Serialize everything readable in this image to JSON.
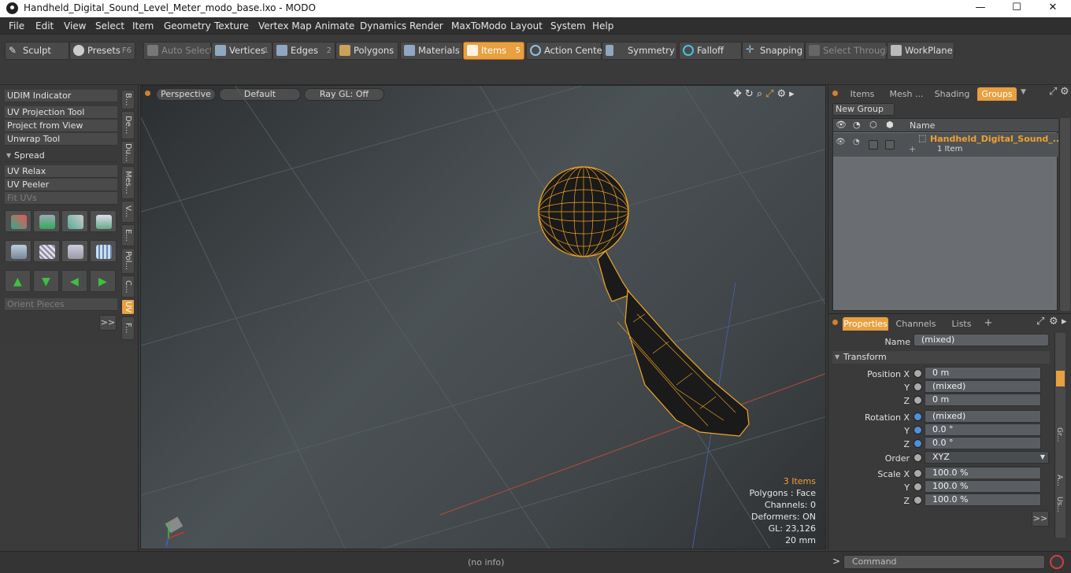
{
  "window": {
    "title": "Handheld_Digital_Sound_Level_Meter_modo_base.lxo - MODO",
    "minimize": "—",
    "maximize": "☐",
    "close": "✕"
  },
  "menu": [
    "File",
    "Edit",
    "View",
    "Select",
    "Item",
    "Geometry",
    "Texture",
    "Vertex Map",
    "Animate",
    "Dynamics",
    "Render",
    "MaxToModo",
    "Layout",
    "System",
    "Help"
  ],
  "toolbar": {
    "sculpt": "Sculpt",
    "presets": "Presets",
    "presets_key": "F6",
    "auto_select": "Auto Select",
    "vertices": "Vertices",
    "vertices_num": "1",
    "edges": "Edges",
    "edges_num": "2",
    "polygons": "Polygons",
    "materials": "Materials",
    "items": "Items",
    "items_num": "5",
    "action_center": "Action Center",
    "symmetry": "Symmetry",
    "falloff": "Falloff",
    "snapping": "Snapping",
    "select_through": "Select Through",
    "workplane": "WorkPlane"
  },
  "left_panel": {
    "udim": "UDIM Indicator",
    "uv_projection": "UV Projection Tool",
    "project_from_view": "Project from View",
    "unwrap": "Unwrap Tool",
    "spread": "Spread",
    "uv_relax": "UV Relax",
    "uv_peeler": "UV Peeler",
    "fit_uvs": "Fit UVs",
    "orient_pieces": "Orient Pieces",
    "more": ">>",
    "vtabs": [
      "B...",
      "De...",
      "Du...",
      "Mes...",
      "V...",
      "E...",
      "Pol...",
      "C...",
      "UV",
      "F..."
    ]
  },
  "viewport": {
    "perspective": "Perspective",
    "default": "Default",
    "raygl": "Ray GL: Off",
    "stats": {
      "items": "3 Items",
      "polygons": "Polygons : Face",
      "channels": "Channels: 0",
      "deformers": "Deformers: ON",
      "gl": "GL: 23,126",
      "size": "20 mm"
    }
  },
  "groups_panel": {
    "tabs": [
      "Items",
      "Mesh ...",
      "Shading",
      "Groups"
    ],
    "new_group": "New Group",
    "col_name": "Name",
    "row_name": "Handheld_Digital_Sound_...",
    "row_count": "1 Item"
  },
  "properties_panel": {
    "tabs": [
      "Properties",
      "Channels",
      "Lists"
    ],
    "add": "+",
    "name_label": "Name",
    "name_value": "(mixed)",
    "transform": "Transform",
    "position_x_label": "Position X",
    "position_x": "0 m",
    "position_y": "(mixed)",
    "position_z": "0 m",
    "rotation_x_label": "Rotation X",
    "rotation_x": "(mixed)",
    "rotation_y": "0.0 °",
    "rotation_z": "0.0 °",
    "order_label": "Order",
    "order_value": "XYZ",
    "scale_x_label": "Scale X",
    "scale_x": "100.0 %",
    "scale_y": "100.0 %",
    "scale_z": "100.0 %",
    "y": "Y",
    "z": "Z",
    "more": ">>",
    "side_tabs": [
      "Gr...",
      "A...",
      "Us..."
    ]
  },
  "statusbar": {
    "info": "(no info)",
    "prompt": ">",
    "command_placeholder": "Command"
  },
  "colors": {
    "accent": "#e8a040",
    "wire": "#f5a623"
  }
}
